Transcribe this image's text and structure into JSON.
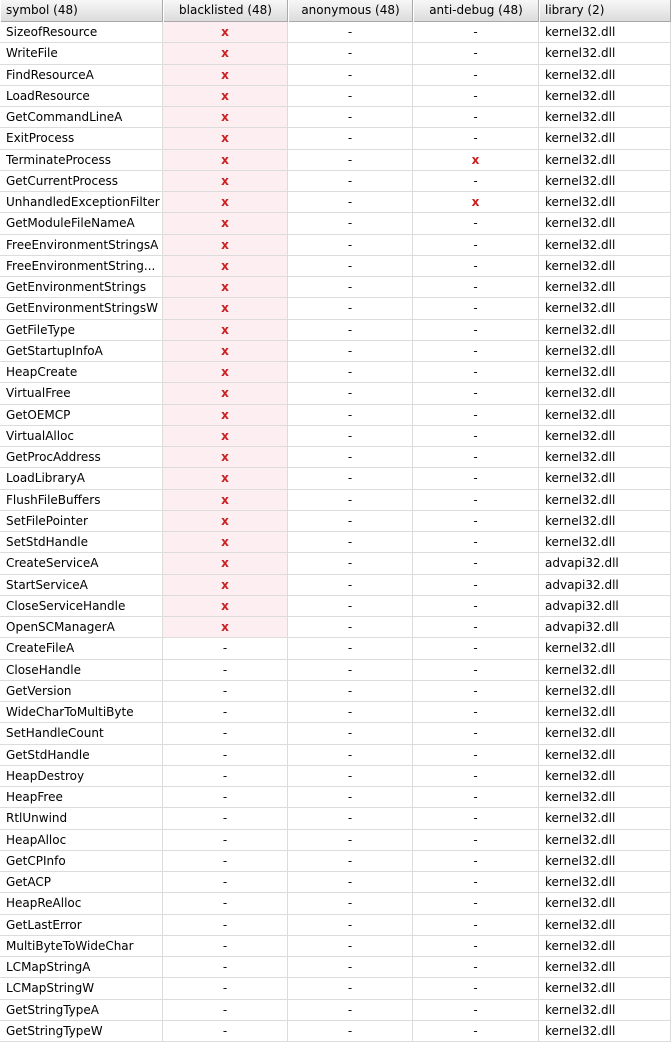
{
  "header": {
    "symbol": "symbol (48)",
    "blacklisted": "blacklisted (48)",
    "anonymous": "anonymous (48)",
    "antidebug": "anti-debug (48)",
    "library": "library (2)"
  },
  "marks": {
    "x": "x",
    "none": "-"
  },
  "colors": {
    "x_mark": "#cc1f1f",
    "blacklisted_bg": "#fdeef2"
  },
  "rows": [
    {
      "symbol": "SizeofResource",
      "blacklisted": true,
      "anonymous": false,
      "antidebug": false,
      "library": "kernel32.dll"
    },
    {
      "symbol": "WriteFile",
      "blacklisted": true,
      "anonymous": false,
      "antidebug": false,
      "library": "kernel32.dll"
    },
    {
      "symbol": "FindResourceA",
      "blacklisted": true,
      "anonymous": false,
      "antidebug": false,
      "library": "kernel32.dll"
    },
    {
      "symbol": "LoadResource",
      "blacklisted": true,
      "anonymous": false,
      "antidebug": false,
      "library": "kernel32.dll"
    },
    {
      "symbol": "GetCommandLineA",
      "blacklisted": true,
      "anonymous": false,
      "antidebug": false,
      "library": "kernel32.dll"
    },
    {
      "symbol": "ExitProcess",
      "blacklisted": true,
      "anonymous": false,
      "antidebug": false,
      "library": "kernel32.dll"
    },
    {
      "symbol": "TerminateProcess",
      "blacklisted": true,
      "anonymous": false,
      "antidebug": true,
      "library": "kernel32.dll"
    },
    {
      "symbol": "GetCurrentProcess",
      "blacklisted": true,
      "anonymous": false,
      "antidebug": false,
      "library": "kernel32.dll"
    },
    {
      "symbol": "UnhandledExceptionFilter",
      "blacklisted": true,
      "anonymous": false,
      "antidebug": true,
      "library": "kernel32.dll"
    },
    {
      "symbol": "GetModuleFileNameA",
      "blacklisted": true,
      "anonymous": false,
      "antidebug": false,
      "library": "kernel32.dll"
    },
    {
      "symbol": "FreeEnvironmentStringsA",
      "blacklisted": true,
      "anonymous": false,
      "antidebug": false,
      "library": "kernel32.dll"
    },
    {
      "symbol": "FreeEnvironmentString...",
      "blacklisted": true,
      "anonymous": false,
      "antidebug": false,
      "library": "kernel32.dll"
    },
    {
      "symbol": "GetEnvironmentStrings",
      "blacklisted": true,
      "anonymous": false,
      "antidebug": false,
      "library": "kernel32.dll"
    },
    {
      "symbol": "GetEnvironmentStringsW",
      "blacklisted": true,
      "anonymous": false,
      "antidebug": false,
      "library": "kernel32.dll"
    },
    {
      "symbol": "GetFileType",
      "blacklisted": true,
      "anonymous": false,
      "antidebug": false,
      "library": "kernel32.dll"
    },
    {
      "symbol": "GetStartupInfoA",
      "blacklisted": true,
      "anonymous": false,
      "antidebug": false,
      "library": "kernel32.dll"
    },
    {
      "symbol": "HeapCreate",
      "blacklisted": true,
      "anonymous": false,
      "antidebug": false,
      "library": "kernel32.dll"
    },
    {
      "symbol": "VirtualFree",
      "blacklisted": true,
      "anonymous": false,
      "antidebug": false,
      "library": "kernel32.dll"
    },
    {
      "symbol": "GetOEMCP",
      "blacklisted": true,
      "anonymous": false,
      "antidebug": false,
      "library": "kernel32.dll"
    },
    {
      "symbol": "VirtualAlloc",
      "blacklisted": true,
      "anonymous": false,
      "antidebug": false,
      "library": "kernel32.dll"
    },
    {
      "symbol": "GetProcAddress",
      "blacklisted": true,
      "anonymous": false,
      "antidebug": false,
      "library": "kernel32.dll"
    },
    {
      "symbol": "LoadLibraryA",
      "blacklisted": true,
      "anonymous": false,
      "antidebug": false,
      "library": "kernel32.dll"
    },
    {
      "symbol": "FlushFileBuffers",
      "blacklisted": true,
      "anonymous": false,
      "antidebug": false,
      "library": "kernel32.dll"
    },
    {
      "symbol": "SetFilePointer",
      "blacklisted": true,
      "anonymous": false,
      "antidebug": false,
      "library": "kernel32.dll"
    },
    {
      "symbol": "SetStdHandle",
      "blacklisted": true,
      "anonymous": false,
      "antidebug": false,
      "library": "kernel32.dll"
    },
    {
      "symbol": "CreateServiceA",
      "blacklisted": true,
      "anonymous": false,
      "antidebug": false,
      "library": "advapi32.dll"
    },
    {
      "symbol": "StartServiceA",
      "blacklisted": true,
      "anonymous": false,
      "antidebug": false,
      "library": "advapi32.dll"
    },
    {
      "symbol": "CloseServiceHandle",
      "blacklisted": true,
      "anonymous": false,
      "antidebug": false,
      "library": "advapi32.dll"
    },
    {
      "symbol": "OpenSCManagerA",
      "blacklisted": true,
      "anonymous": false,
      "antidebug": false,
      "library": "advapi32.dll"
    },
    {
      "symbol": "CreateFileA",
      "blacklisted": false,
      "anonymous": false,
      "antidebug": false,
      "library": "kernel32.dll"
    },
    {
      "symbol": "CloseHandle",
      "blacklisted": false,
      "anonymous": false,
      "antidebug": false,
      "library": "kernel32.dll"
    },
    {
      "symbol": "GetVersion",
      "blacklisted": false,
      "anonymous": false,
      "antidebug": false,
      "library": "kernel32.dll"
    },
    {
      "symbol": "WideCharToMultiByte",
      "blacklisted": false,
      "anonymous": false,
      "antidebug": false,
      "library": "kernel32.dll"
    },
    {
      "symbol": "SetHandleCount",
      "blacklisted": false,
      "anonymous": false,
      "antidebug": false,
      "library": "kernel32.dll"
    },
    {
      "symbol": "GetStdHandle",
      "blacklisted": false,
      "anonymous": false,
      "antidebug": false,
      "library": "kernel32.dll"
    },
    {
      "symbol": "HeapDestroy",
      "blacklisted": false,
      "anonymous": false,
      "antidebug": false,
      "library": "kernel32.dll"
    },
    {
      "symbol": "HeapFree",
      "blacklisted": false,
      "anonymous": false,
      "antidebug": false,
      "library": "kernel32.dll"
    },
    {
      "symbol": "RtlUnwind",
      "blacklisted": false,
      "anonymous": false,
      "antidebug": false,
      "library": "kernel32.dll"
    },
    {
      "symbol": "HeapAlloc",
      "blacklisted": false,
      "anonymous": false,
      "antidebug": false,
      "library": "kernel32.dll"
    },
    {
      "symbol": "GetCPInfo",
      "blacklisted": false,
      "anonymous": false,
      "antidebug": false,
      "library": "kernel32.dll"
    },
    {
      "symbol": "GetACP",
      "blacklisted": false,
      "anonymous": false,
      "antidebug": false,
      "library": "kernel32.dll"
    },
    {
      "symbol": "HeapReAlloc",
      "blacklisted": false,
      "anonymous": false,
      "antidebug": false,
      "library": "kernel32.dll"
    },
    {
      "symbol": "GetLastError",
      "blacklisted": false,
      "anonymous": false,
      "antidebug": false,
      "library": "kernel32.dll"
    },
    {
      "symbol": "MultiByteToWideChar",
      "blacklisted": false,
      "anonymous": false,
      "antidebug": false,
      "library": "kernel32.dll"
    },
    {
      "symbol": "LCMapStringA",
      "blacklisted": false,
      "anonymous": false,
      "antidebug": false,
      "library": "kernel32.dll"
    },
    {
      "symbol": "LCMapStringW",
      "blacklisted": false,
      "anonymous": false,
      "antidebug": false,
      "library": "kernel32.dll"
    },
    {
      "symbol": "GetStringTypeA",
      "blacklisted": false,
      "anonymous": false,
      "antidebug": false,
      "library": "kernel32.dll"
    },
    {
      "symbol": "GetStringTypeW",
      "blacklisted": false,
      "anonymous": false,
      "antidebug": false,
      "library": "kernel32.dll"
    }
  ]
}
